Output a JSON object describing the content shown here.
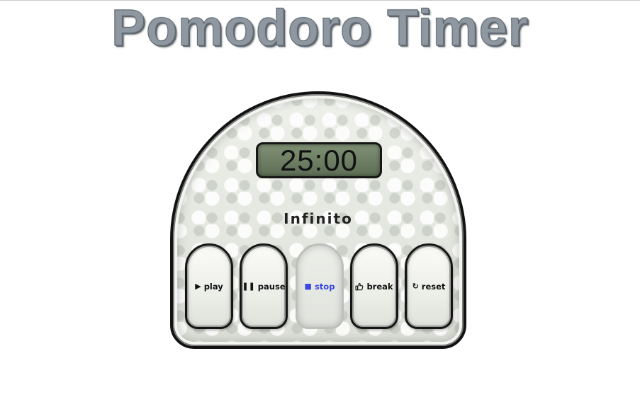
{
  "app": {
    "title": "Pomodoro Timer"
  },
  "timer": {
    "display": "25:00",
    "mode_label": "Infinito"
  },
  "controls": {
    "buttons": [
      {
        "label": "play",
        "icon": "play-icon",
        "active": false
      },
      {
        "label": "pause",
        "icon": "pause-icon",
        "active": false
      },
      {
        "label": "stop",
        "icon": "stop-icon",
        "active": true
      },
      {
        "label": "break",
        "icon": "thumbs-up-icon",
        "active": false
      },
      {
        "label": "reset",
        "icon": "reset-icon",
        "active": false
      }
    ]
  },
  "colors": {
    "title": "#8f98a1",
    "lcd_background": "#6f8065",
    "active_button_text": "#3a47e0",
    "outline": "#141414"
  }
}
